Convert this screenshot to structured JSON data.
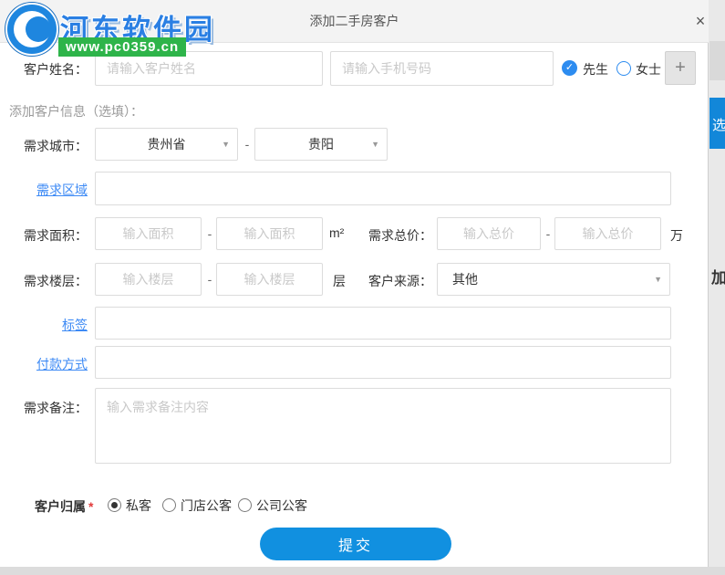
{
  "watermark": {
    "site_name": "河东软件园",
    "site_url": "www.pc0359.cn"
  },
  "dialog": {
    "title": "添加二手房客户",
    "close_label": "×"
  },
  "customer_row": {
    "name_label": "客户姓名：",
    "name_placeholder": "请输入客户姓名",
    "phone_placeholder": "请输入手机号码",
    "male_check": "✓",
    "male_label": "先生",
    "female_label": "女士",
    "add_label": "+"
  },
  "optional_section_label": "添加客户信息（选填）：",
  "city_row": {
    "label": "需求城市：",
    "province": "贵州省",
    "separator": "-",
    "city": "贵阳",
    "caret": "▼"
  },
  "region_row": {
    "label": "需求区域"
  },
  "area_row": {
    "label": "需求面积：",
    "min_placeholder": "输入面积",
    "separator": "-",
    "max_placeholder": "输入面积",
    "unit": "m²"
  },
  "price_row": {
    "label": "需求总价：",
    "min_placeholder": "输入总价",
    "separator": "-",
    "max_placeholder": "输入总价",
    "unit": "万"
  },
  "floor_row": {
    "label": "需求楼层：",
    "min_placeholder": "输入楼层",
    "separator": "-",
    "max_placeholder": "输入楼层",
    "unit": "层"
  },
  "source_row": {
    "label": "客户来源：",
    "value": "其他",
    "caret": "▼"
  },
  "tag_row": {
    "label": "标签"
  },
  "payment_row": {
    "label": "付款方式"
  },
  "remark_row": {
    "label": "需求备注：",
    "placeholder": "输入需求备注内容"
  },
  "ownership_row": {
    "label": "客户归属",
    "required": "*",
    "options": [
      {
        "label": "私客",
        "selected": true
      },
      {
        "label": "门店公客",
        "selected": false
      },
      {
        "label": "公司公客",
        "selected": false
      }
    ]
  },
  "submit_label": "提交",
  "background_fragments": {
    "blue_text": "选",
    "dark_text": "加"
  },
  "colors": {
    "accent_blue": "#1190e0",
    "link_blue": "#3d8af5",
    "logo_blue": "#1e86df",
    "green": "#2eb44a",
    "required_red": "#e23b3b"
  }
}
